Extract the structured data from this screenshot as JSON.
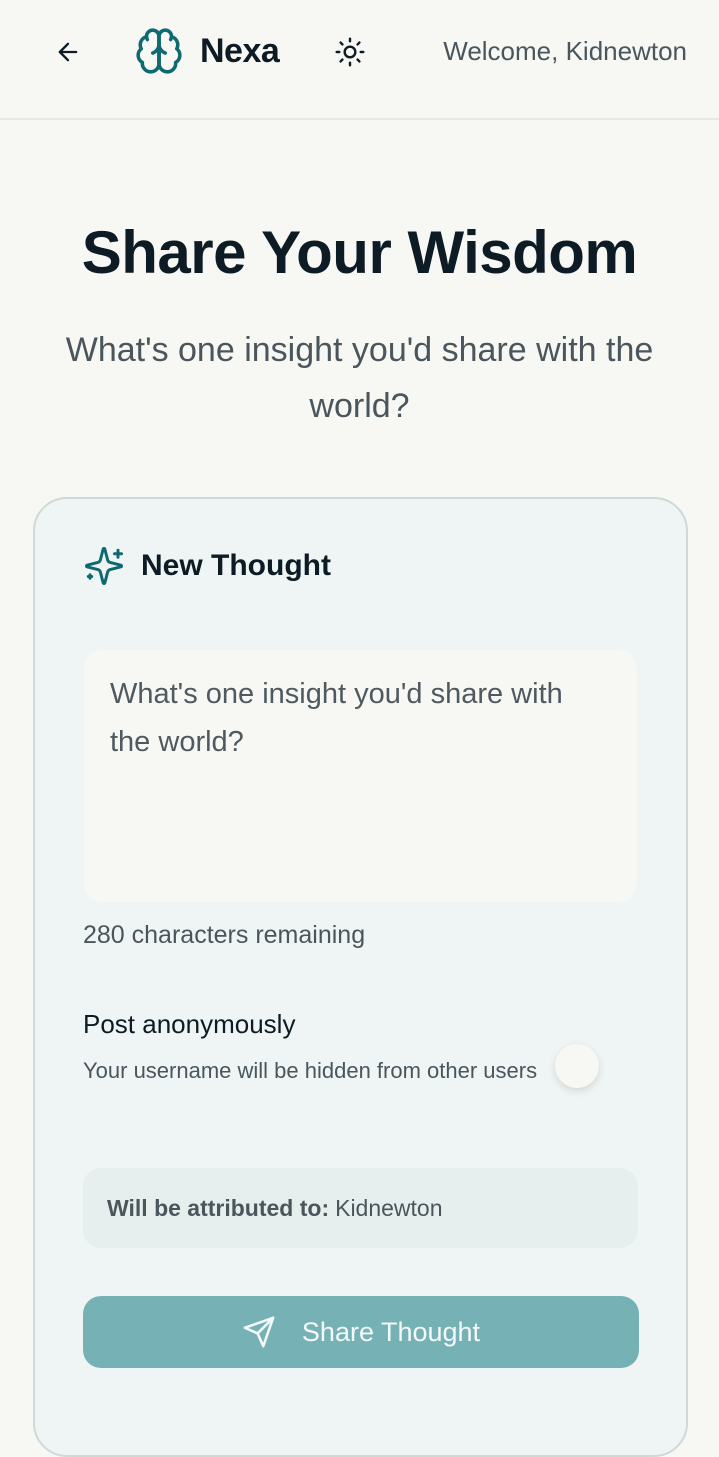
{
  "header": {
    "back_icon": "arrow-left-icon",
    "brand_icon": "brain-icon",
    "brand_name": "Nexa",
    "theme_icon": "sun-icon",
    "welcome_text": "Welcome, Kidnewton"
  },
  "main": {
    "title": "Share Your Wisdom",
    "subtitle": "What's one insight you'd share with the world?"
  },
  "card": {
    "icon": "sparkles-icon",
    "title": "New Thought",
    "input_placeholder": "What's one insight you'd share with the world?",
    "input_value": "",
    "char_count_text": "280 characters remaining",
    "anonymous": {
      "label": "Post anonymously",
      "description": "Your username will be hidden from other users",
      "enabled": false
    },
    "attribution": {
      "label": "Will be attributed to:",
      "username": "Kidnewton"
    },
    "share_button": {
      "icon": "send-icon",
      "label": "Share Thought"
    }
  },
  "colors": {
    "accent": "#0e6a70",
    "button_bg": "#76b1b5",
    "page_bg": "#f7f7f4",
    "card_bg": "#eef5f4"
  }
}
